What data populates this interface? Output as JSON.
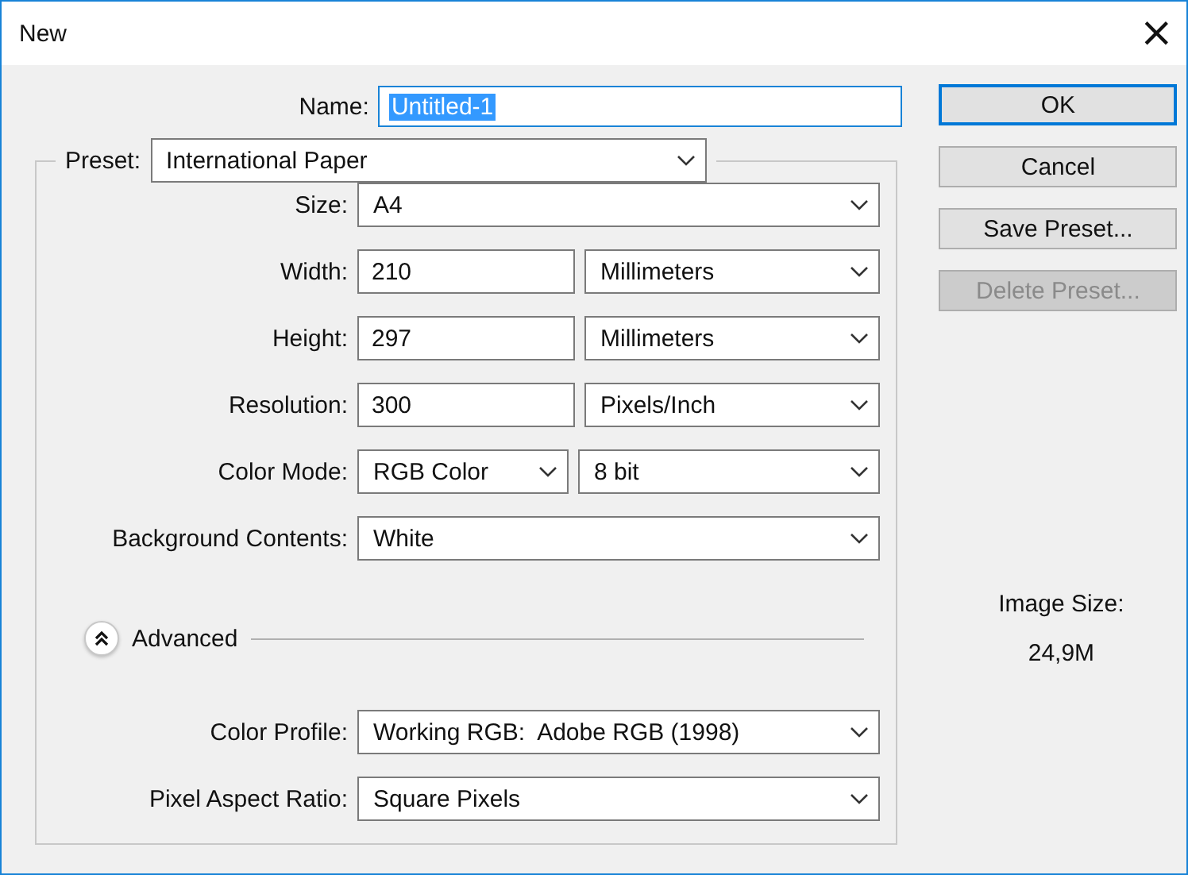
{
  "window": {
    "title": "New",
    "close": "×"
  },
  "name": {
    "label": "Name:",
    "value": "Untitled-1",
    "selected": true
  },
  "preset": {
    "label": "Preset:",
    "value": "International Paper"
  },
  "rows": [
    {
      "label": "Size:",
      "controls": [
        {
          "kind": "select",
          "value": "A4"
        }
      ]
    },
    {
      "label": "Width:",
      "controls": [
        {
          "kind": "input",
          "value": "210"
        },
        {
          "kind": "select",
          "value": "Millimeters"
        }
      ]
    },
    {
      "label": "Height:",
      "controls": [
        {
          "kind": "input",
          "value": "297"
        },
        {
          "kind": "select",
          "value": "Millimeters"
        }
      ]
    },
    {
      "label": "Resolution:",
      "controls": [
        {
          "kind": "input",
          "value": "300"
        },
        {
          "kind": "select",
          "value": "Pixels/Inch"
        }
      ]
    },
    {
      "label": "Color Mode:",
      "controls": [
        {
          "kind": "select",
          "value": "RGB Color"
        },
        {
          "kind": "select",
          "value": "8 bit"
        }
      ]
    },
    {
      "label": "Background Contents:",
      "controls": [
        {
          "kind": "select",
          "value": "White"
        }
      ]
    }
  ],
  "advanced": {
    "label": "Advanced",
    "expanded": true,
    "rows": [
      {
        "label": "Color Profile:",
        "controls": [
          {
            "kind": "select",
            "value": "Working RGB:  Adobe RGB (1998)"
          }
        ]
      },
      {
        "label": "Pixel Aspect Ratio:",
        "controls": [
          {
            "kind": "select",
            "value": "Square Pixels"
          }
        ]
      }
    ]
  },
  "buttons": [
    {
      "label": "OK",
      "default": true,
      "disabled": false
    },
    {
      "label": "Cancel",
      "default": false,
      "disabled": false
    },
    {
      "label": "Save Preset...",
      "default": false,
      "disabled": false
    },
    {
      "label": "Delete Preset...",
      "default": false,
      "disabled": true
    }
  ],
  "image_size": {
    "label": "Image Size:",
    "value": "24,9M"
  }
}
